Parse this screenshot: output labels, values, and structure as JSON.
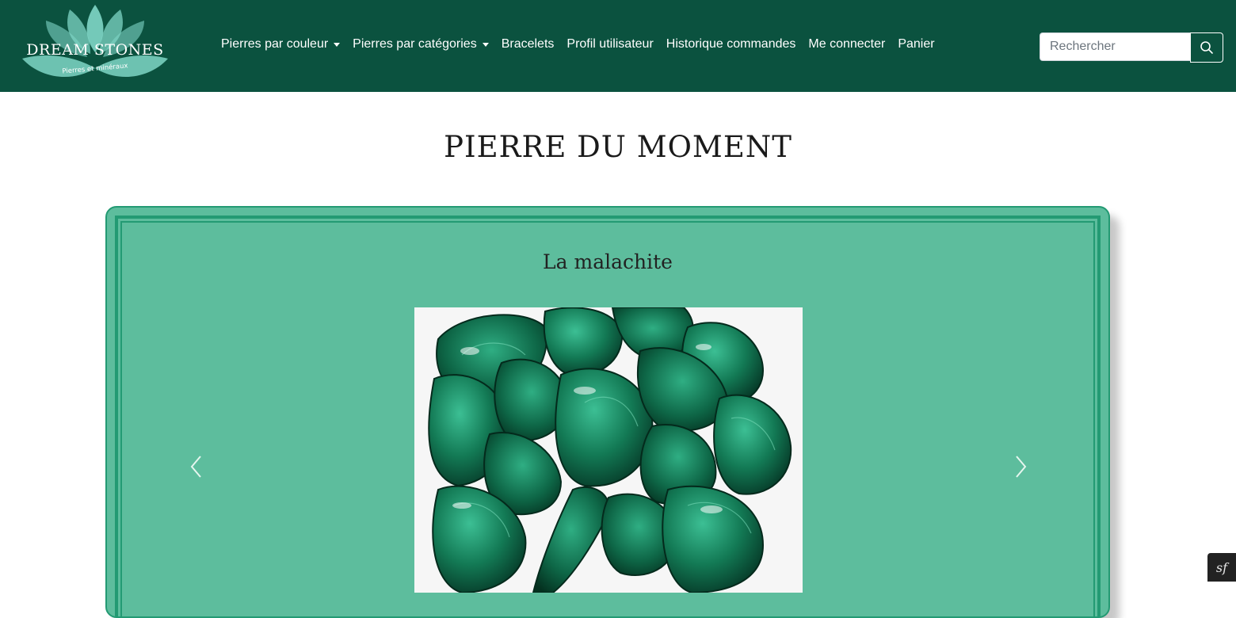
{
  "brand": {
    "name": "DREAM STONES",
    "tagline": "Pierres et minéraux"
  },
  "nav": {
    "items": [
      {
        "label": "Pierres par couleur",
        "dropdown": true
      },
      {
        "label": "Pierres par catégories",
        "dropdown": true
      },
      {
        "label": "Bracelets",
        "dropdown": false
      },
      {
        "label": "Profil utilisateur",
        "dropdown": false
      },
      {
        "label": "Historique commandes",
        "dropdown": false
      },
      {
        "label": "Me connecter",
        "dropdown": false
      },
      {
        "label": "Panier",
        "dropdown": false
      }
    ]
  },
  "search": {
    "placeholder": "Rechercher",
    "icon": "search-icon"
  },
  "main": {
    "title": "PIERRE DU MOMENT",
    "carousel": {
      "stone_name": "La malachite",
      "image_icon": "malachite-stones-image",
      "prev_icon": "chevron-left-icon",
      "next_icon": "chevron-right-icon"
    }
  },
  "debug": {
    "icon": "symfony-icon",
    "symbol": "sf"
  },
  "colors": {
    "navbar": "#0b523f",
    "card": "#5dbd9d",
    "card_border": "#239a73",
    "logo_petal": "#7fd6c6"
  }
}
